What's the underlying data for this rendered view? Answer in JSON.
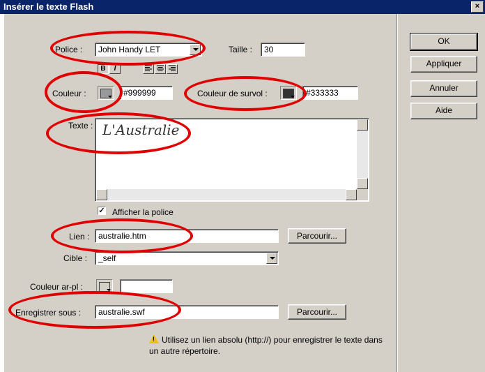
{
  "window": {
    "title": "Insérer le texte Flash",
    "close_glyph": "×"
  },
  "font": {
    "label": "Police :",
    "value": "John Handy LET"
  },
  "size": {
    "label": "Taille :",
    "value": "30"
  },
  "style_buttons": {
    "bold": "B",
    "italic": "I"
  },
  "color": {
    "label": "Couleur :",
    "value": "#999999",
    "swatch": "#999999"
  },
  "hover_color": {
    "label": "Couleur de survol :",
    "value": "#333333",
    "swatch": "#333333"
  },
  "text": {
    "label": "Texte :",
    "value": "L'Australie"
  },
  "show_font": {
    "label": "Afficher la police",
    "checked": "✓"
  },
  "link": {
    "label": "Lien :",
    "value": "australie.htm",
    "browse": "Parcourir..."
  },
  "target": {
    "label": "Cible :",
    "value": "_self"
  },
  "bg_color": {
    "label": "Couleur ar-pl :",
    "value": "",
    "swatch": "#d4d0c8"
  },
  "save_as": {
    "label": "Enregistrer sous :",
    "value": "australie.swf",
    "browse": "Parcourir..."
  },
  "note": {
    "text": "Utilisez un lien absolu (http://) pour enregistrer le texte dans un autre répertoire."
  },
  "buttons": {
    "ok": "OK",
    "apply": "Appliquer",
    "cancel": "Annuler",
    "help": "Aide"
  },
  "annotation_color": "#e00000"
}
